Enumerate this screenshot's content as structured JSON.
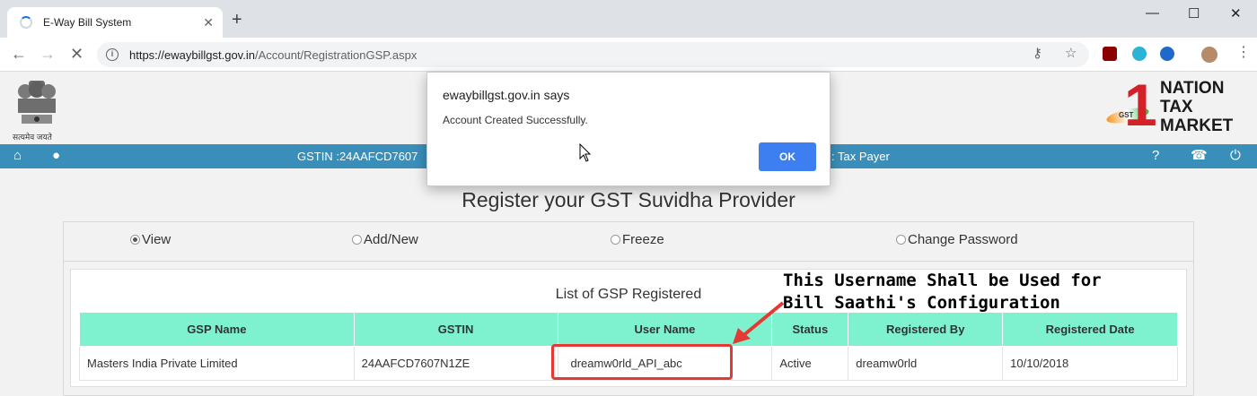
{
  "browser": {
    "tab_title": "E-Way Bill System",
    "tab_close": "✕",
    "new_tab": "+",
    "url_host": "https://ewaybillgst.gov.in",
    "url_path": "/Account/RegistrationGSP.aspx",
    "window_controls": [
      "—",
      "☐",
      "✕"
    ]
  },
  "brand": {
    "emblem_caption": "सत्यमेव जयते",
    "logo_digit": "1",
    "logo_words": [
      "NATION",
      "TAX",
      "MARKET"
    ],
    "logo_gst": "GST"
  },
  "bluebar": {
    "gstin_text": "GSTIN :24AAFCD7607",
    "role_text": ": Tax Payer"
  },
  "page": {
    "title": "Register your GST Suvidha Provider",
    "radios": [
      {
        "label": "View",
        "selected": true
      },
      {
        "label": "Add/New",
        "selected": false
      },
      {
        "label": "Freeze",
        "selected": false
      },
      {
        "label": "Change Password",
        "selected": false
      }
    ],
    "list_title": "List of GSP Registered",
    "table": {
      "headers": [
        "GSP Name",
        "GSTIN",
        "User Name",
        "Status",
        "Registered By",
        "Registered Date"
      ],
      "rows": [
        [
          "Masters India Private Limited",
          "24AAFCD7607N1ZE",
          "dreamw0rld_API_abc",
          "Active",
          "dreamw0rld",
          "10/10/2018"
        ]
      ]
    }
  },
  "annotation": {
    "line1": "This Username Shall be Used for",
    "line2": "Bill Saathi's Configuration",
    "color": "#e53935"
  },
  "dialog": {
    "title": "ewaybillgst.gov.in says",
    "message": "Account Created Successfully.",
    "ok_label": "OK"
  },
  "colors": {
    "header_bar": "#3a8fba",
    "table_header": "#7ef2cf",
    "ok_button": "#3d7ff0"
  }
}
